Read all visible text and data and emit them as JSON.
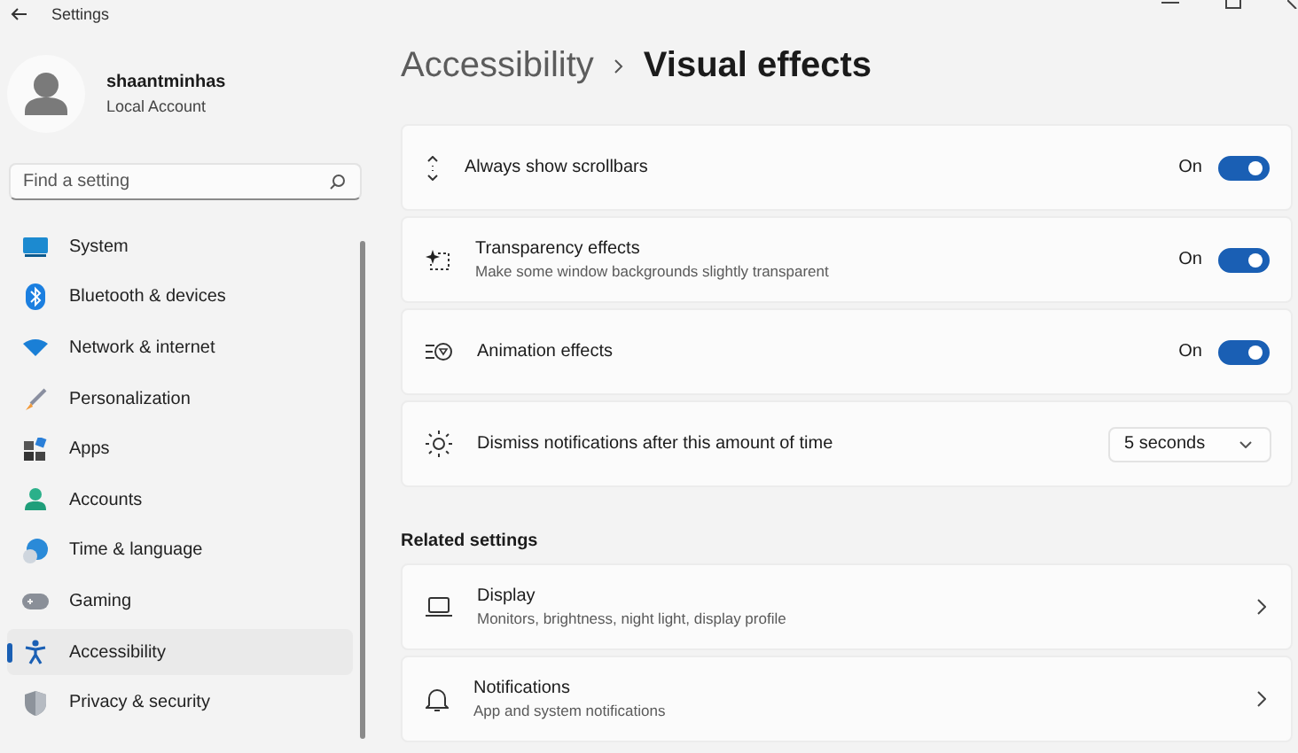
{
  "window": {
    "title": "Settings"
  },
  "profile": {
    "name": "shaantminhas",
    "account_type": "Local Account"
  },
  "search": {
    "placeholder": "Find a setting"
  },
  "sidebar": {
    "items": [
      {
        "label": "System",
        "selected": false
      },
      {
        "label": "Bluetooth & devices",
        "selected": false
      },
      {
        "label": "Network & internet",
        "selected": false
      },
      {
        "label": "Personalization",
        "selected": false
      },
      {
        "label": "Apps",
        "selected": false
      },
      {
        "label": "Accounts",
        "selected": false
      },
      {
        "label": "Time & language",
        "selected": false
      },
      {
        "label": "Gaming",
        "selected": false
      },
      {
        "label": "Accessibility",
        "selected": true
      },
      {
        "label": "Privacy & security",
        "selected": false
      }
    ]
  },
  "breadcrumb": [
    "Accessibility",
    "Visual effects"
  ],
  "settings": [
    {
      "kind": "toggle",
      "title": "Always show scrollbars",
      "state_label": "On",
      "on": true
    },
    {
      "kind": "toggle",
      "title": "Transparency effects",
      "description": "Make some window backgrounds slightly transparent",
      "state_label": "On",
      "on": true
    },
    {
      "kind": "toggle",
      "title": "Animation effects",
      "state_label": "On",
      "on": true
    },
    {
      "kind": "dropdown",
      "title": "Dismiss notifications after this amount of time",
      "value": "5 seconds"
    }
  ],
  "related": {
    "heading": "Related settings",
    "items": [
      {
        "title": "Display",
        "description": "Monitors, brightness, night light, display profile"
      },
      {
        "title": "Notifications",
        "description": "App and system notifications"
      }
    ]
  }
}
